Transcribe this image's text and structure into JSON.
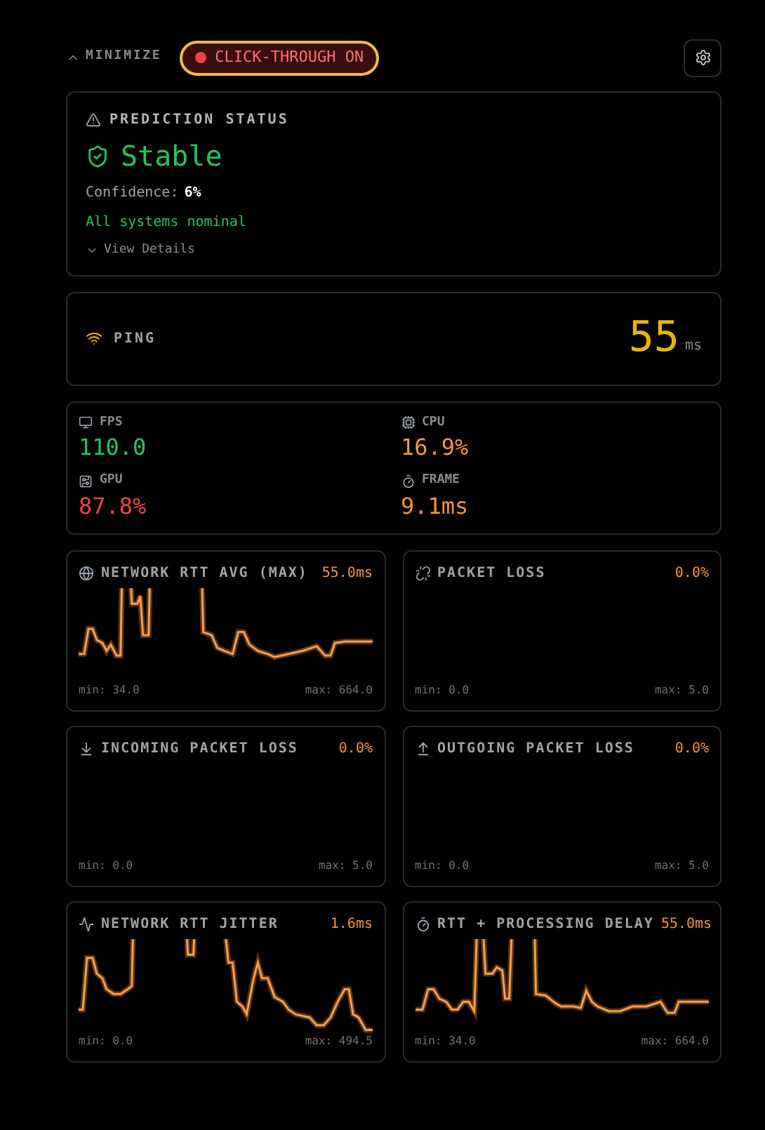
{
  "header": {
    "minimize_label": "MINIMIZE",
    "click_through": {
      "label": "CLICK-THROUGH ON",
      "on": true
    }
  },
  "prediction": {
    "title": "PREDICTION STATUS",
    "status": "Stable",
    "confidence_label": "Confidence:",
    "confidence_value": "6%",
    "message": "All systems nominal",
    "details_label": "View Details",
    "expanded": false
  },
  "ping": {
    "label": "PING",
    "value": "55",
    "unit": "ms"
  },
  "stats": [
    {
      "label": "FPS",
      "value": "110.0",
      "color": "#22c55e"
    },
    {
      "label": "CPU",
      "value": "16.9%",
      "color": "#fb923c"
    },
    {
      "label": "GPU",
      "value": "87.8%",
      "color": "#ef4444"
    },
    {
      "label": "FRAME",
      "value": "9.1ms",
      "color": "#fb923c"
    }
  ],
  "charts": [
    {
      "title": "NETWORK RTT AVG (MAX)",
      "value": "55.0ms",
      "min": "min: 34.0",
      "max": "max: 664.0",
      "kind": "trace"
    },
    {
      "title": "PACKET LOSS",
      "value": "0.0%",
      "min": "min: 0.0",
      "max": "max: 5.0",
      "kind": "empty"
    },
    {
      "title": "INCOMING PACKET LOSS",
      "value": "0.0%",
      "min": "min: 0.0",
      "max": "max: 5.0",
      "kind": "empty"
    },
    {
      "title": "OUTGOING PACKET LOSS",
      "value": "0.0%",
      "min": "min: 0.0",
      "max": "max: 5.0",
      "kind": "empty"
    },
    {
      "title": "NETWORK RTT JITTER",
      "value": "1.6ms",
      "min": "min: 0.0",
      "max": "max: 494.5",
      "kind": "trace"
    },
    {
      "title": "RTT + PROCESSING DELAY",
      "value": "55.0ms",
      "min": "min: 34.0",
      "max": "max: 664.0",
      "kind": "trace"
    }
  ]
}
